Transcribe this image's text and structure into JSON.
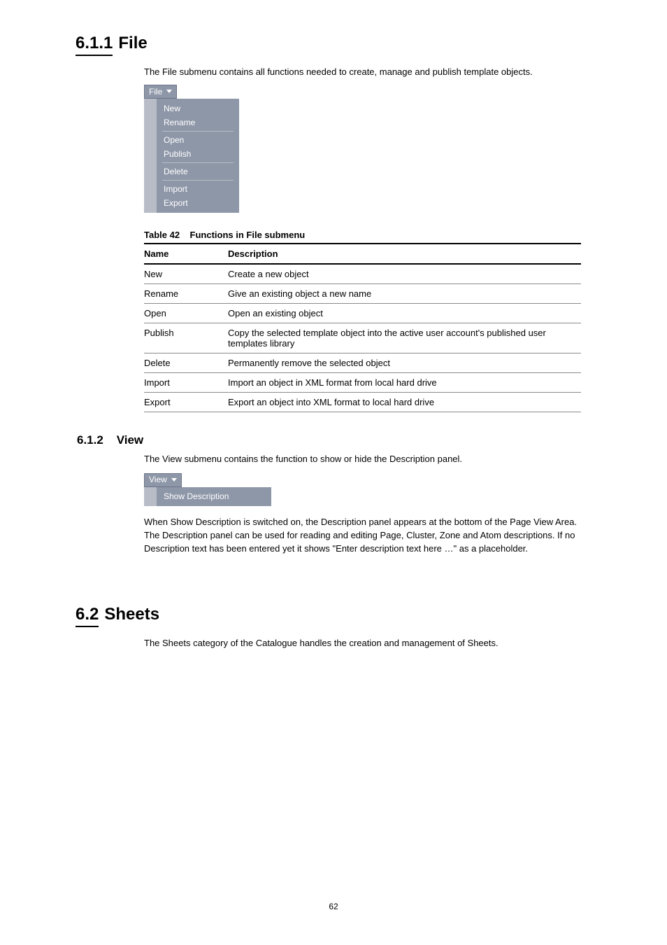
{
  "section_file": {
    "number": "6.1.1",
    "title": "File",
    "intro": "The File submenu contains all functions needed to create, manage and publish template objects.",
    "button_label": "File",
    "menu_groups": [
      [
        "New",
        "Rename"
      ],
      [
        "Open",
        "Publish"
      ],
      [
        "Delete"
      ],
      [
        "Import",
        "Export"
      ]
    ],
    "table": {
      "caption_prefix": "Table 42",
      "caption": "Functions in File submenu",
      "header": {
        "a": "Name",
        "b": "Description"
      },
      "rows": [
        {
          "a": "New",
          "b": "Create a new object"
        },
        {
          "a": "Rename",
          "b": "Give an existing object a new name"
        },
        {
          "a": "Open",
          "b": "Open an existing object"
        },
        {
          "a": "Publish",
          "b": "Copy the selected template object into the active user account's published user templates library"
        },
        {
          "a": "Delete",
          "b": "Permanently remove the selected object"
        },
        {
          "a": "Import",
          "b": "Import an object in XML format from local hard drive"
        },
        {
          "a": "Export",
          "b": "Export an object into XML format to local hard drive"
        }
      ]
    }
  },
  "section_view": {
    "number": "6.1.2",
    "title": "View",
    "intro": "The View submenu contains the function to show or hide the Description panel.",
    "button_label": "View",
    "menu_items": [
      "Show Description"
    ],
    "after_para_1": "When Show Description is switched on, the Description panel appears at the bottom of the Page View Area. The Description panel can be used for reading and editing Page, Cluster, Zone and Atom descriptions. If no Description text has been entered yet it shows \"Enter description text here …\" as a placeholder."
  },
  "section_sheets": {
    "number": "6.2",
    "title": "Sheets",
    "intro": "The Sheets category of the Catalogue handles the creation and management of Sheets."
  },
  "page_number": "62"
}
